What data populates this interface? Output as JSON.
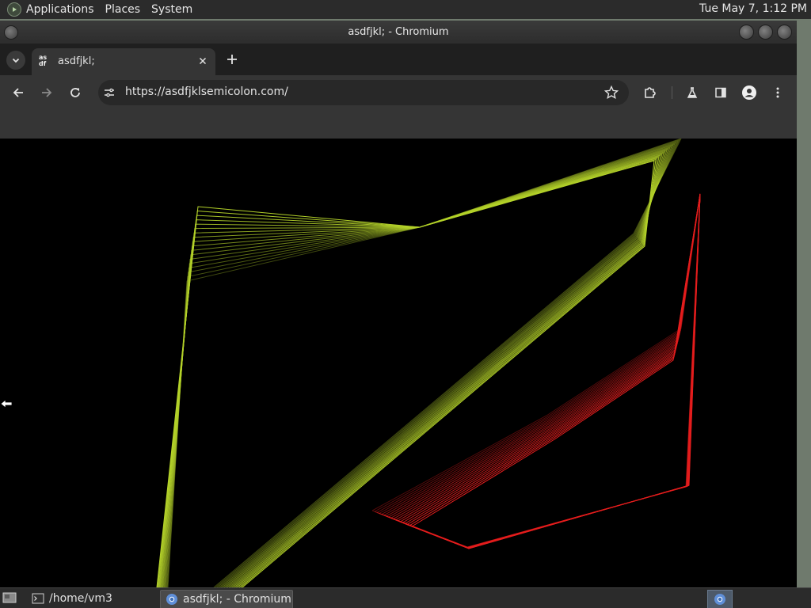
{
  "top_panel": {
    "menus": [
      "Applications",
      "Places",
      "System"
    ],
    "clock": "Tue May 7,  1:12 PM"
  },
  "window": {
    "title": "asdfjkl; - Chromium"
  },
  "tabs": [
    {
      "favicon_text": "as df",
      "title": "asdfjkl;"
    }
  ],
  "omnibox": {
    "url": "https://asdfjklsemicolon.com/"
  },
  "taskbar": {
    "tasks": [
      {
        "label": "/home/vm3",
        "icon": "terminal-icon"
      },
      {
        "label": "asdfjkl; - Chromium",
        "icon": "chromium-icon"
      }
    ]
  },
  "colors": {
    "yellow_green": "#b4d22a",
    "red": "#e51e1e",
    "page_bg": "#000000"
  },
  "icons": {
    "panel_logo": "distro-logo-icon",
    "back": "back-arrow-icon",
    "forward": "forward-arrow-icon",
    "reload": "reload-icon",
    "site_info": "tune-icon",
    "bookmark": "star-icon",
    "extensions": "puzzle-icon",
    "labs": "flask-icon",
    "side_panel": "side-panel-icon",
    "profile": "profile-icon",
    "menu": "kebab-menu-icon"
  }
}
